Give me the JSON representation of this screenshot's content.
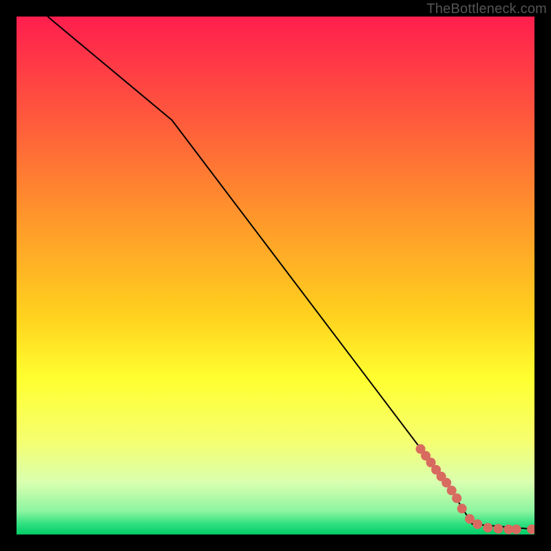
{
  "watermark": "TheBottleneck.com",
  "chart_data": {
    "type": "line",
    "title": "",
    "xlabel": "",
    "ylabel": "",
    "xlim": [
      0,
      100
    ],
    "ylim": [
      0,
      100
    ],
    "series": [
      {
        "name": "curve",
        "type": "line",
        "x": [
          6,
          30,
          83,
          88,
          100
        ],
        "y": [
          100,
          80,
          10,
          2,
          1
        ]
      },
      {
        "name": "markers",
        "type": "scatter",
        "x": [
          78,
          79,
          80,
          81,
          82,
          83,
          84,
          85,
          86,
          87.5,
          89,
          91,
          93,
          95,
          96.5,
          99.5
        ],
        "y": [
          16.5,
          15.2,
          13.9,
          12.5,
          11.2,
          10,
          8.5,
          7,
          5,
          3,
          2,
          1.3,
          1.1,
          1,
          1,
          1
        ]
      }
    ],
    "gradient_stops": [
      {
        "offset": 0.0,
        "color": "#ff1e4e"
      },
      {
        "offset": 0.2,
        "color": "#ff5a3c"
      },
      {
        "offset": 0.4,
        "color": "#ff9a2a"
      },
      {
        "offset": 0.58,
        "color": "#ffd21e"
      },
      {
        "offset": 0.7,
        "color": "#ffff30"
      },
      {
        "offset": 0.82,
        "color": "#f5ff70"
      },
      {
        "offset": 0.9,
        "color": "#d9ffb0"
      },
      {
        "offset": 0.955,
        "color": "#8cf5a0"
      },
      {
        "offset": 0.98,
        "color": "#30e080"
      },
      {
        "offset": 1.0,
        "color": "#00cc66"
      }
    ],
    "marker_color": "#d86b60",
    "line_color": "#000000"
  }
}
